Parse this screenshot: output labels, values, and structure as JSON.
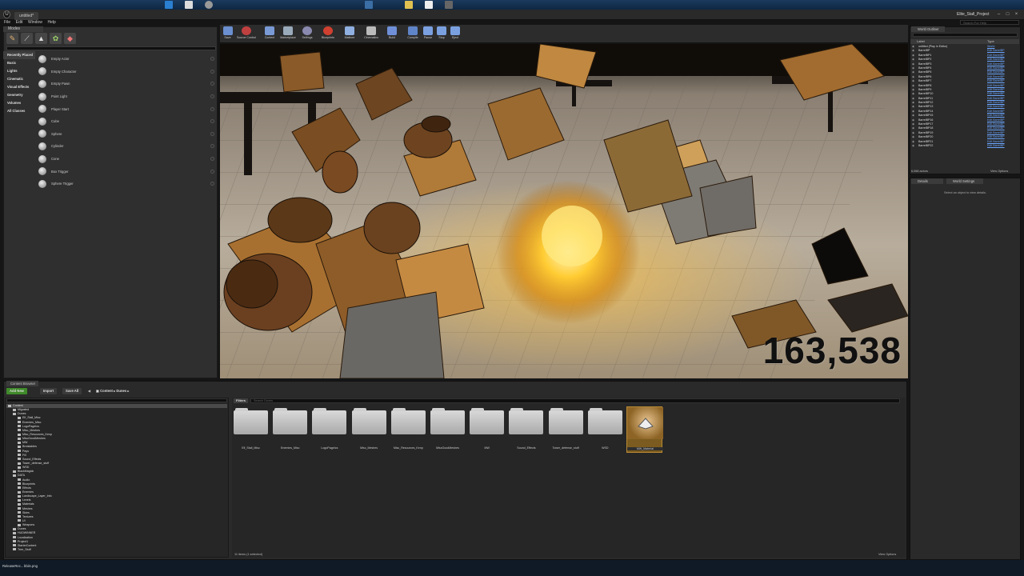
{
  "window": {
    "doc_tab": "untitled*",
    "project_title": "Elite_Stall_Project",
    "menus": [
      "File",
      "Edit",
      "Window",
      "Help"
    ],
    "search_help_placeholder": "Search For Help"
  },
  "modes": {
    "tab": "Modes",
    "categories": [
      "Recently Placed",
      "Basic",
      "Lights",
      "Cinematic",
      "Visual Effects",
      "Geometry",
      "Volumes",
      "All Classes"
    ],
    "selected_category": 0,
    "items": [
      "Empty Actor",
      "Empty Character",
      "Empty Pawn",
      "Point Light",
      "Player Start",
      "Cube",
      "Sphere",
      "Cylinder",
      "Cone",
      "Box Trigger",
      "Sphere Trigger"
    ]
  },
  "toolbar": {
    "buttons": [
      {
        "label": "Save",
        "color": "#6b8fd0"
      },
      {
        "label": "Source Control",
        "color": "#c04040"
      },
      {
        "label": "Content",
        "color": "#7a9ad6"
      },
      {
        "label": "Marketplace",
        "color": "#9aa"
      },
      {
        "label": "Settings",
        "color": "#8a8ab0"
      },
      {
        "label": "Blueprints",
        "color": "#d04030"
      },
      {
        "label": "Matinee",
        "color": "#8fb0e0"
      },
      {
        "label": "Cinematics",
        "color": "#bbb"
      },
      {
        "label": "Build",
        "color": "#6f8fd8"
      },
      {
        "label": "Compile",
        "color": "#5f84c8"
      },
      {
        "label": "Pause",
        "color": "#7aa0e0"
      },
      {
        "label": "Stop",
        "color": "#7aa0e0"
      },
      {
        "label": "Eject",
        "color": "#7aa0e0"
      }
    ]
  },
  "viewport": {
    "counter": "163,538"
  },
  "outliner": {
    "tab": "World Outliner",
    "col_label": "Label",
    "col_type": "Type",
    "rows": [
      {
        "name": "untitled (Play In Editor)",
        "type": "World"
      },
      {
        "name": "BarrelBP",
        "type": "Edit BarrelBP"
      },
      {
        "name": "BarrelBP1",
        "type": "Edit BarrelBP"
      },
      {
        "name": "BarrelBP2",
        "type": "Edit BarrelBP"
      },
      {
        "name": "BarrelBP3",
        "type": "Edit BarrelBP"
      },
      {
        "name": "BarrelBP4",
        "type": "Edit BarrelBP"
      },
      {
        "name": "BarrelBP5",
        "type": "Edit BarrelBP"
      },
      {
        "name": "BarrelBP6",
        "type": "Edit BarrelBP"
      },
      {
        "name": "BarrelBP7",
        "type": "Edit BarrelBP"
      },
      {
        "name": "BarrelBP8",
        "type": "Edit BarrelBP"
      },
      {
        "name": "BarrelBP9",
        "type": "Edit BarrelBP"
      },
      {
        "name": "BarrelBP10",
        "type": "Edit BarrelBP"
      },
      {
        "name": "BarrelBP11",
        "type": "Edit BarrelBP"
      },
      {
        "name": "BarrelBP12",
        "type": "Edit BarrelBP"
      },
      {
        "name": "BarrelBP13",
        "type": "Edit BarrelBP"
      },
      {
        "name": "BarrelBP14",
        "type": "Edit BarrelBP"
      },
      {
        "name": "BarrelBP15",
        "type": "Edit BarrelBP"
      },
      {
        "name": "BarrelBP16",
        "type": "Edit BarrelBP"
      },
      {
        "name": "BarrelBP17",
        "type": "Edit BarrelBP"
      },
      {
        "name": "BarrelBP18",
        "type": "Edit BarrelBP"
      },
      {
        "name": "BarrelBP19",
        "type": "Edit BarrelBP"
      },
      {
        "name": "BarrelBP20",
        "type": "Edit BarrelBP"
      },
      {
        "name": "BarrelBP21",
        "type": "Edit BarrelBP"
      },
      {
        "name": "BarrelBP22",
        "type": "Edit BarrelBP"
      }
    ],
    "footer": "6,068 actors",
    "view_options": "View Options"
  },
  "details": {
    "tab1": "Details",
    "tab2": "World Settings",
    "message": "Select an object to view details."
  },
  "content_browser": {
    "tab": "Content Browser",
    "add_new": "Add New",
    "import": "Import",
    "save_all": "Save All",
    "path": [
      "Content",
      "Dunes"
    ],
    "filters": "Filters",
    "search_placeholder": "Search Dunes",
    "tree": [
      {
        "name": "Content",
        "sel": true
      },
      {
        "name": "Migrated"
      },
      {
        "name": "Dunes"
      },
      {
        "name": "Elf_Stall_Misc"
      },
      {
        "name": "Enemies_Misc"
      },
      {
        "name": "LogoPageIcs"
      },
      {
        "name": "Misc_Meshes"
      },
      {
        "name": "Misc_Resources_Kenp"
      },
      {
        "name": "MiscGoodMeshes"
      },
      {
        "name": "MW"
      },
      {
        "name": "Breakables"
      },
      {
        "name": "Pays"
      },
      {
        "name": "Fill"
      },
      {
        "name": "Sound_Effects"
      },
      {
        "name": "Tower_defense_stuff"
      },
      {
        "name": "WSD"
      },
      {
        "name": "BlackMagick"
      },
      {
        "name": "DATA"
      },
      {
        "name": "Audio"
      },
      {
        "name": "Blueprints"
      },
      {
        "name": "Effects"
      },
      {
        "name": "Enemies"
      },
      {
        "name": "Landscape_Layer_Info"
      },
      {
        "name": "Levels"
      },
      {
        "name": "Materials"
      },
      {
        "name": "Meshes"
      },
      {
        "name": "Skies"
      },
      {
        "name": "Textures"
      },
      {
        "name": "UI"
      },
      {
        "name": "Weapons"
      },
      {
        "name": "Dunes"
      },
      {
        "name": "HUDWINNER"
      },
      {
        "name": "Localization"
      },
      {
        "name": "Project1"
      },
      {
        "name": "StarterContent"
      },
      {
        "name": "Tree_Stuff"
      }
    ],
    "assets": [
      "Elf_Stall_Misc",
      "Enemies_Misc",
      "LogoPageIcs",
      "Misc_Meshes",
      "Misc_Resources_Kenp",
      "MiscGoodMeshes",
      "MW",
      "Sound_Effects",
      "Tower_defense_stuff",
      "WSD"
    ],
    "material_asset": "MW_Material",
    "status": "11 items (1 selected)",
    "view_options": "View Options"
  },
  "taskbar": {
    "items": [
      "ReleaseRec...",
      "bbiin.png"
    ]
  }
}
